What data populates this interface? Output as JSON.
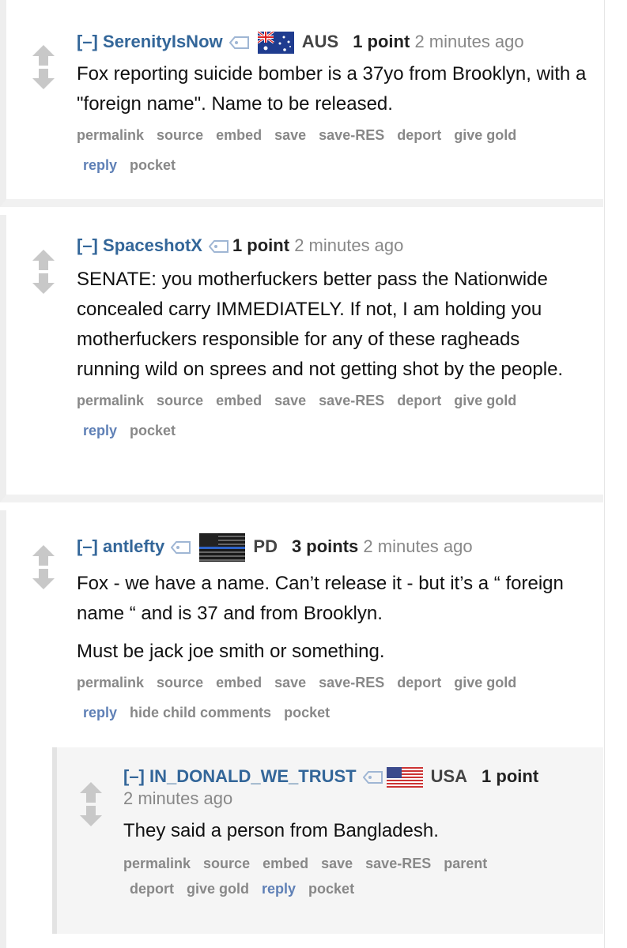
{
  "comments": [
    {
      "expand": "[–]",
      "author": "SerenityIsNow",
      "flair": "AUS",
      "score": "1 point",
      "time": "2 minutes ago",
      "body": [
        "Fox reporting suicide bomber is a 37yo from Brooklyn, with a \"foreign name\". Name to be released."
      ],
      "buttons_row1": [
        "permalink",
        "source",
        "embed",
        "save",
        "save-RES",
        "deport",
        "give gold"
      ],
      "buttons_row2": [
        "reply",
        "pocket"
      ]
    },
    {
      "expand": "[–]",
      "author": "SpaceshotX",
      "score": "1 point",
      "time": "2 minutes ago",
      "body": [
        "SENATE: you motherfuckers better pass the Nationwide concealed carry IMMEDIATELY. If not, I am holding you motherfuckers responsible for any of these ragheads running wild on sprees and not getting shot by the people."
      ],
      "buttons_row1": [
        "permalink",
        "source",
        "embed",
        "save",
        "save-RES",
        "deport",
        "give gold"
      ],
      "buttons_row2": [
        "reply",
        "pocket"
      ]
    },
    {
      "expand": "[–]",
      "author": "antlefty",
      "flair": "PD",
      "score": "3 points",
      "time": "2 minutes ago",
      "body": [
        "Fox - we have a name. Can’t release it - but it’s a “ foreign name “ and is 37 and from Brooklyn.",
        "Must be jack joe smith or something."
      ],
      "buttons_row1": [
        "permalink",
        "source",
        "embed",
        "save",
        "save-RES",
        "deport",
        "give gold"
      ],
      "buttons_row2": [
        "reply",
        "hide child comments",
        "pocket"
      ]
    }
  ],
  "child": {
    "expand": "[–]",
    "author": "IN_DONALD_WE_TRUST",
    "flair": "USA",
    "score": "1 point",
    "time": "2 minutes ago",
    "body": [
      "They said a person from Bangladesh."
    ],
    "buttons_row1": [
      "permalink",
      "source",
      "embed",
      "save",
      "save-RES",
      "parent"
    ],
    "buttons_row2": [
      "deport",
      "give gold",
      "reply",
      "pocket"
    ]
  },
  "icons": {
    "upvote": "upvote-arrow-icon",
    "downvote": "downvote-arrow-icon",
    "tag": "user-tag-icon",
    "flag_aus": "australia-flag-icon",
    "flag_thin_blue_line": "thin-blue-line-flag-icon",
    "flag_usa": "usa-flag-icon"
  },
  "colors": {
    "author": "#336699",
    "reply": "#5f80b6",
    "button_gray": "#888888",
    "arrow_gray": "#c8c8c8"
  }
}
